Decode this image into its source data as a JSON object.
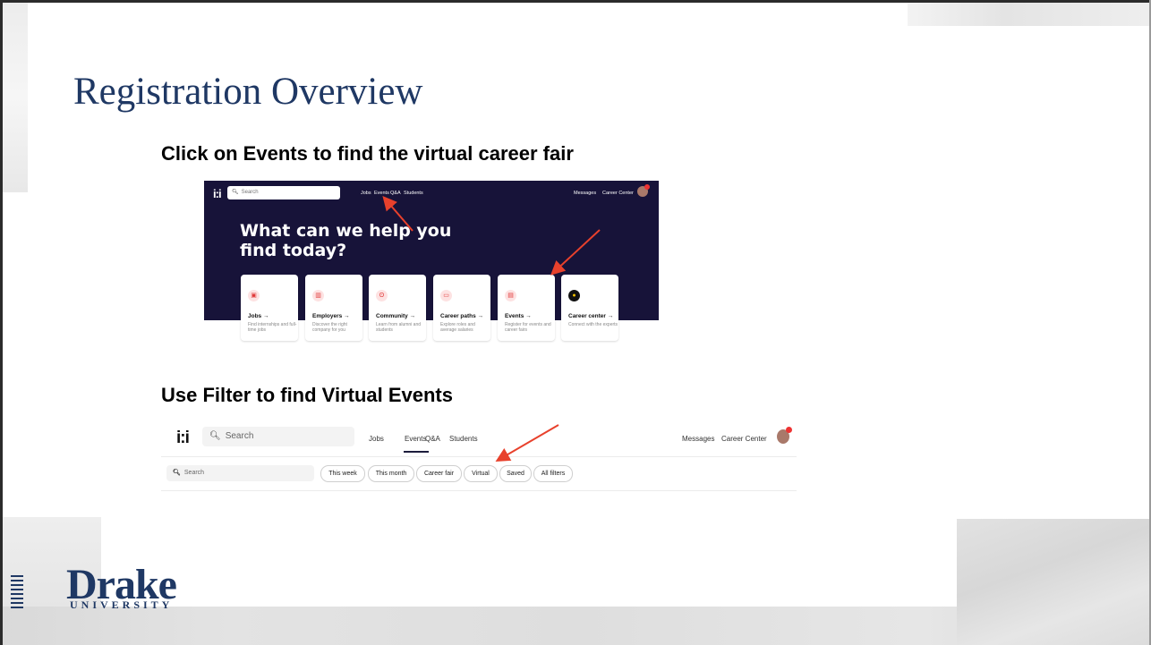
{
  "slide": {
    "title": "Registration Overview",
    "subtitle1": "Click on Events to find the virtual career fair",
    "subtitle2": "Use Filter to find Virtual Events"
  },
  "shot1": {
    "logo": "i:i",
    "search_placeholder": "Search",
    "nav": [
      "Jobs",
      "Events",
      "Q&A",
      "Students"
    ],
    "messages": "Messages",
    "career_center": "Career Center",
    "hero": "What can we help you find today?",
    "cards": [
      {
        "title": "Jobs →",
        "desc": "Find internships and full-time jobs",
        "icon": "briefcase-icon"
      },
      {
        "title": "Employers →",
        "desc": "Discover the right company for you",
        "icon": "building-icon"
      },
      {
        "title": "Community →",
        "desc": "Learn from alumni and students",
        "icon": "people-icon"
      },
      {
        "title": "Career paths →",
        "desc": "Explore roles and average salaries",
        "icon": "money-icon"
      },
      {
        "title": "Events →",
        "desc": "Register for events and career fairs",
        "icon": "calendar-icon"
      },
      {
        "title": "Career center →",
        "desc": "Connect with the experts",
        "icon": "career-center-logo"
      }
    ]
  },
  "shot2": {
    "logo": "i:i",
    "search_placeholder": "Search",
    "nav": [
      "Jobs",
      "Events",
      "Q&A",
      "Students"
    ],
    "messages": "Messages",
    "career_center": "Career Center",
    "filter_search_placeholder": "Search",
    "chips": [
      "This week",
      "This month",
      "Career fair",
      "Virtual",
      "Saved",
      "All filters"
    ]
  },
  "branding": {
    "name": "Drake",
    "tagline": "UNIVERSITY"
  },
  "colors": {
    "title": "#1f3864",
    "arrow": "#e8412c",
    "dark_bg": "#171339"
  }
}
